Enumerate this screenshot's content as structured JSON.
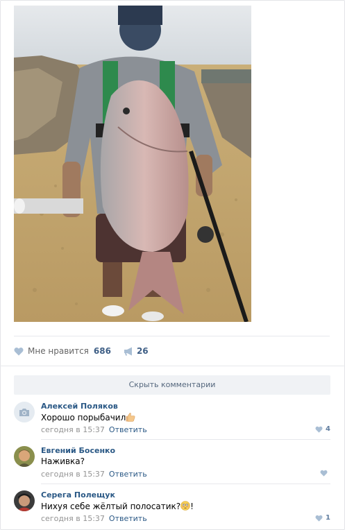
{
  "post": {
    "actions": {
      "like_label": "Мне нравится",
      "like_count": "686",
      "share_count": "26"
    },
    "hide_comments_label": "Скрыть комментарии"
  },
  "comments": [
    {
      "author": "Алексей Поляков",
      "text": "Хорошо порыбачил",
      "emoji": "thumbs-up",
      "date": "сегодня в 15:37",
      "reply": "Ответить",
      "likes": "4"
    },
    {
      "author": "Евгений Босенко",
      "text": "Наживка?",
      "date": "сегодня в 15:37",
      "reply": "Ответить",
      "likes": ""
    },
    {
      "author": "Серега Полещук",
      "text": "Нихуя себе жёлтый полосатик?",
      "emoji": "flushed-face",
      "text_suffix": "!",
      "date": "сегодня в 15:37",
      "reply": "Ответить",
      "likes": "1"
    }
  ],
  "colors": {
    "link": "#2a5885",
    "meta": "#939393",
    "like_icon": "#a9bed4",
    "button_bg": "#f0f2f5"
  }
}
